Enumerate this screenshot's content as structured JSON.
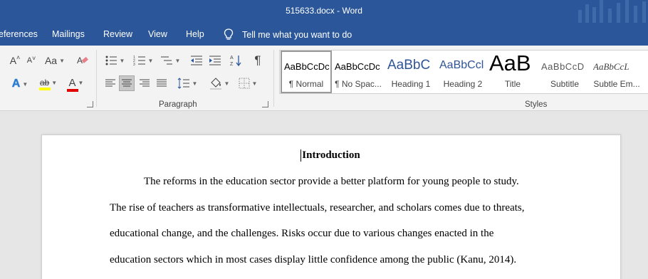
{
  "window": {
    "title": "515633.docx  -  Word"
  },
  "tabs": [
    {
      "label": "eferences"
    },
    {
      "label": "Mailings"
    },
    {
      "label": "Review"
    },
    {
      "label": "View"
    },
    {
      "label": "Help"
    }
  ],
  "tellme": {
    "label": "Tell me what you want to do"
  },
  "ribbon": {
    "font": {
      "grow_label": "A",
      "case_label": "Aa",
      "effects_label": "A",
      "highlight_label": "ab",
      "fontcolor_label": "A",
      "highlight_color": "#ffff00",
      "fontcolor_color": "#e00000"
    },
    "paragraph": {
      "group_label": "Paragraph",
      "pilcrow": "¶"
    },
    "styles": {
      "group_label": "Styles",
      "items": [
        {
          "sample": "AaBbCcDc",
          "label": "¶ Normal"
        },
        {
          "sample": "AaBbCcDc",
          "label": "¶ No Spac..."
        },
        {
          "sample": "AaBbC",
          "label": "Heading 1"
        },
        {
          "sample": "AaBbCcl",
          "label": "Heading 2"
        },
        {
          "sample": "AaB",
          "label": "Title"
        },
        {
          "sample": "AaBbCcD",
          "label": "Subtitle"
        },
        {
          "sample": "AaBbCcL",
          "label": "Subtle Em..."
        }
      ]
    }
  },
  "colors": {
    "accent": "#2b579a",
    "heading_blue": "#2f5496"
  },
  "document": {
    "heading": "Introduction",
    "lines": [
      "The reforms in the education sector provide a better platform for young people to study.",
      "The rise of teachers as transformative intellectuals, researcher, and scholars comes due to threats,",
      "educational change, and the challenges.  Risks occur due to various changes enacted in the",
      "education sectors which in most cases display little confidence among the public (Kanu, 2014)."
    ]
  }
}
